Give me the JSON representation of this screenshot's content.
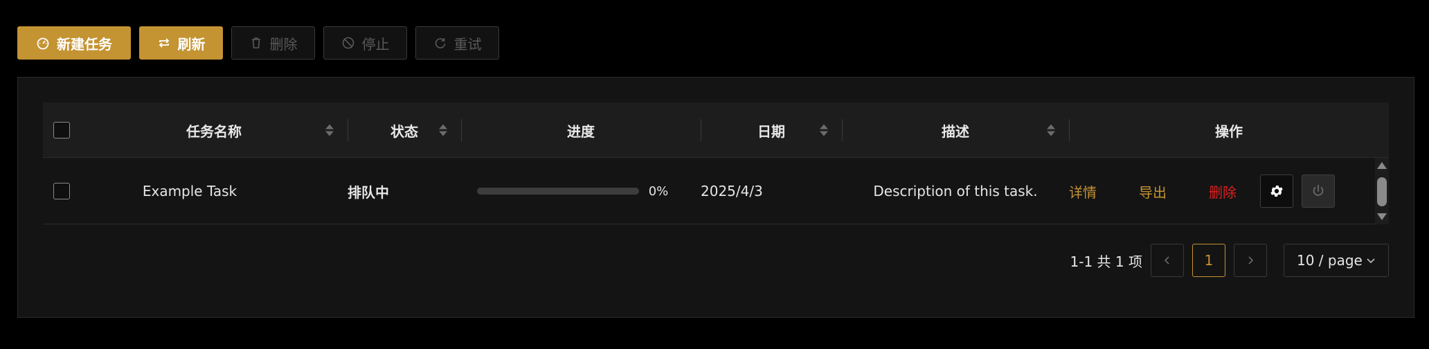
{
  "toolbar": {
    "new_task": "新建任务",
    "refresh": "刷新",
    "delete": "删除",
    "stop": "停止",
    "retry": "重试"
  },
  "table": {
    "columns": {
      "name": "任务名称",
      "status": "状态",
      "progress": "进度",
      "date": "日期",
      "description": "描述",
      "actions": "操作"
    },
    "rows": [
      {
        "name": "Example Task",
        "status": "排队中",
        "progress": 0,
        "progress_text": "0%",
        "date": "2025/4/3",
        "description": "Description of this task.",
        "actions": {
          "details": "详情",
          "export": "导出",
          "delete": "删除"
        }
      }
    ]
  },
  "pagination": {
    "total": "1-1 共 1 项",
    "current_page": "1",
    "page_size": "10 / page"
  },
  "colors": {
    "accent": "#c49332",
    "danger": "#e02020",
    "background": "#000000",
    "panel": "#141414"
  },
  "icons": {
    "new_task": "dashboard-icon",
    "refresh": "refresh-icon",
    "delete": "trash-icon",
    "stop": "stop-icon",
    "retry": "retry-icon",
    "settings": "gear-icon",
    "power": "power-icon"
  }
}
